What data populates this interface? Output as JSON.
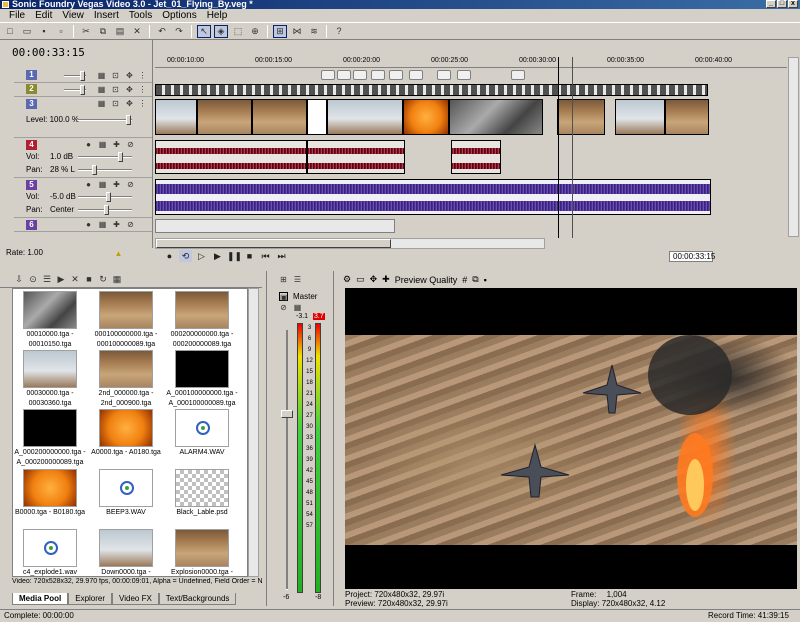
{
  "window": {
    "title": "Sonic Foundry Vegas Video 3.0 - Jet_01_Flying_By.veg *",
    "controls": [
      "_",
      "□",
      "x"
    ]
  },
  "menu": [
    "File",
    "Edit",
    "View",
    "Insert",
    "Tools",
    "Options",
    "Help"
  ],
  "timeline": {
    "timecode": "00:00:33:15",
    "ruler_ticks": [
      "00:00:10:00",
      "00:00:15:00",
      "00:00:20:00",
      "00:00:25:00",
      "00:00:30:00",
      "00:00:35:00",
      "00:00:40:00"
    ],
    "tracks": [
      {
        "num": "1",
        "type": "video",
        "color": "#5a6ab0"
      },
      {
        "num": "2",
        "type": "video",
        "color": "#8a8a30"
      },
      {
        "num": "3",
        "type": "video",
        "color": "#5a6ab0",
        "level_label": "Level: 100.0 %"
      },
      {
        "num": "4",
        "type": "audio",
        "color": "#b02030",
        "vol_label": "Vol:",
        "vol_value": "1.0 dB",
        "pan_label": "Pan:",
        "pan_value": "28 % L"
      },
      {
        "num": "5",
        "type": "audio",
        "color": "#6a40a0",
        "vol_label": "Vol:",
        "vol_value": "-5.0 dB",
        "pan_label": "Pan:",
        "pan_value": "Center"
      },
      {
        "num": "6",
        "type": "audio",
        "color": "#6a40a0"
      }
    ],
    "rate_label": "Rate: 1.00",
    "end_time": "00:00:33:15"
  },
  "media_pool": {
    "items": [
      {
        "caption1": "00010000.tga -",
        "caption2": "00010150.tga",
        "kind": "cockpit"
      },
      {
        "caption1": "000100000000.tga -",
        "caption2": "000100000089.tga",
        "kind": "desert"
      },
      {
        "caption1": "000200000000.tga -",
        "caption2": "000200000089.tga",
        "kind": "desert"
      },
      {
        "caption1": "00030000.tga -",
        "caption2": "00030360.tga",
        "kind": "sky"
      },
      {
        "caption1": "2nd_000000.tga -",
        "caption2": "2nd_000900.tga",
        "kind": "desert"
      },
      {
        "caption1": "A_000100000000.tga -",
        "caption2": "A_000100000089.tga",
        "kind": "black"
      },
      {
        "caption1": "A_000200000000.tga -",
        "caption2": "A_000200000089.tga",
        "kind": "black"
      },
      {
        "caption1": "A0000.tga - A0180.tga",
        "caption2": "",
        "kind": "orange"
      },
      {
        "caption1": "ALARM4.WAV",
        "caption2": "",
        "kind": "wav"
      },
      {
        "caption1": "B0000.tga - B0180.tga",
        "caption2": "",
        "kind": "orange"
      },
      {
        "caption1": "BEEP3.WAV",
        "caption2": "",
        "kind": "wav"
      },
      {
        "caption1": "Black_Lable.psd",
        "caption2": "",
        "kind": "checker"
      },
      {
        "caption1": "c4_explode1.wav",
        "caption2": "",
        "kind": "wav"
      },
      {
        "caption1": "Down0000.tga -",
        "caption2": "",
        "kind": "sky"
      },
      {
        "caption1": "Explosion0000.tga -",
        "caption2": "",
        "kind": "desert"
      }
    ],
    "info": "Video: 720x528x32, 29.970 fps, 00:00:09:01, Alpha = Undefined, Field Order = Non",
    "tabs": [
      "Media Pool",
      "Explorer",
      "Video FX",
      "Text/Backgrounds"
    ]
  },
  "mixer": {
    "label": "Master",
    "peak_left": "-3.1",
    "peak_right": "3.7",
    "scale": [
      "3",
      "6",
      "9",
      "12",
      "15",
      "18",
      "21",
      "24",
      "27",
      "30",
      "33",
      "36",
      "39",
      "42",
      "45",
      "48",
      "51",
      "54",
      "57"
    ],
    "bottom_left": "-6",
    "bottom_right": "-8"
  },
  "preview": {
    "quality_label": "Preview Quality",
    "project_label": "Project:",
    "project_value": "720x480x32, 29.97i",
    "preview_label": "Preview:",
    "preview_value": "720x480x32, 29.97i",
    "frame_label": "Frame:",
    "frame_value": "1,004",
    "display_label": "Display:",
    "display_value": "720x480x32, 4.12"
  },
  "status": {
    "left": "Complete: 00:00:00",
    "record_label": "Record Time: 41:39:15"
  }
}
